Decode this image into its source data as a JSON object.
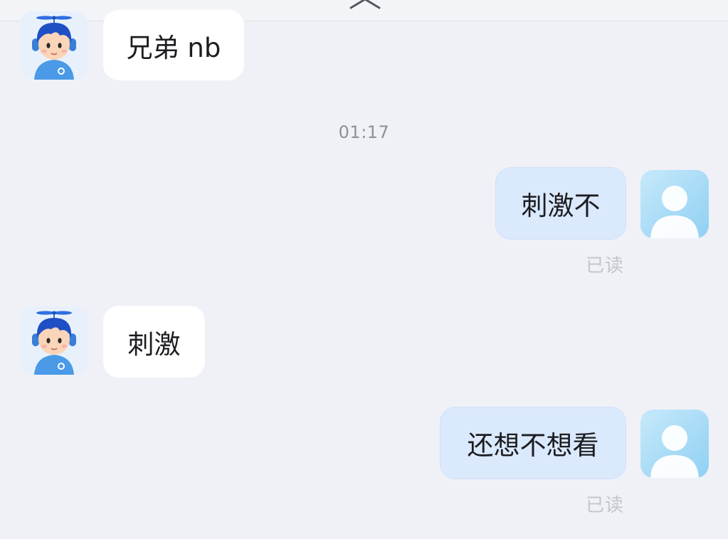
{
  "header": {
    "collapse_icon": "chevron-up-icon"
  },
  "messages": [
    {
      "direction": "incoming",
      "text": "兄弟 nb",
      "avatar_icon": "robot-boy-avatar-icon"
    },
    {
      "direction": "outgoing",
      "text": "刺激不",
      "status": "已读",
      "avatar_icon": "default-user-avatar-icon"
    },
    {
      "direction": "incoming",
      "text": "刺激",
      "avatar_icon": "robot-boy-avatar-icon"
    },
    {
      "direction": "outgoing",
      "text": "还想不想看",
      "status": "已读",
      "avatar_icon": "default-user-avatar-icon"
    }
  ],
  "timestamp": "01:17",
  "colors": {
    "background": "#f0f1f6",
    "incoming_bubble": "#ffffff",
    "outgoing_bubble": "#dbe9fd",
    "status_text": "#c3c5ca",
    "timestamp_text": "#8e9096"
  }
}
